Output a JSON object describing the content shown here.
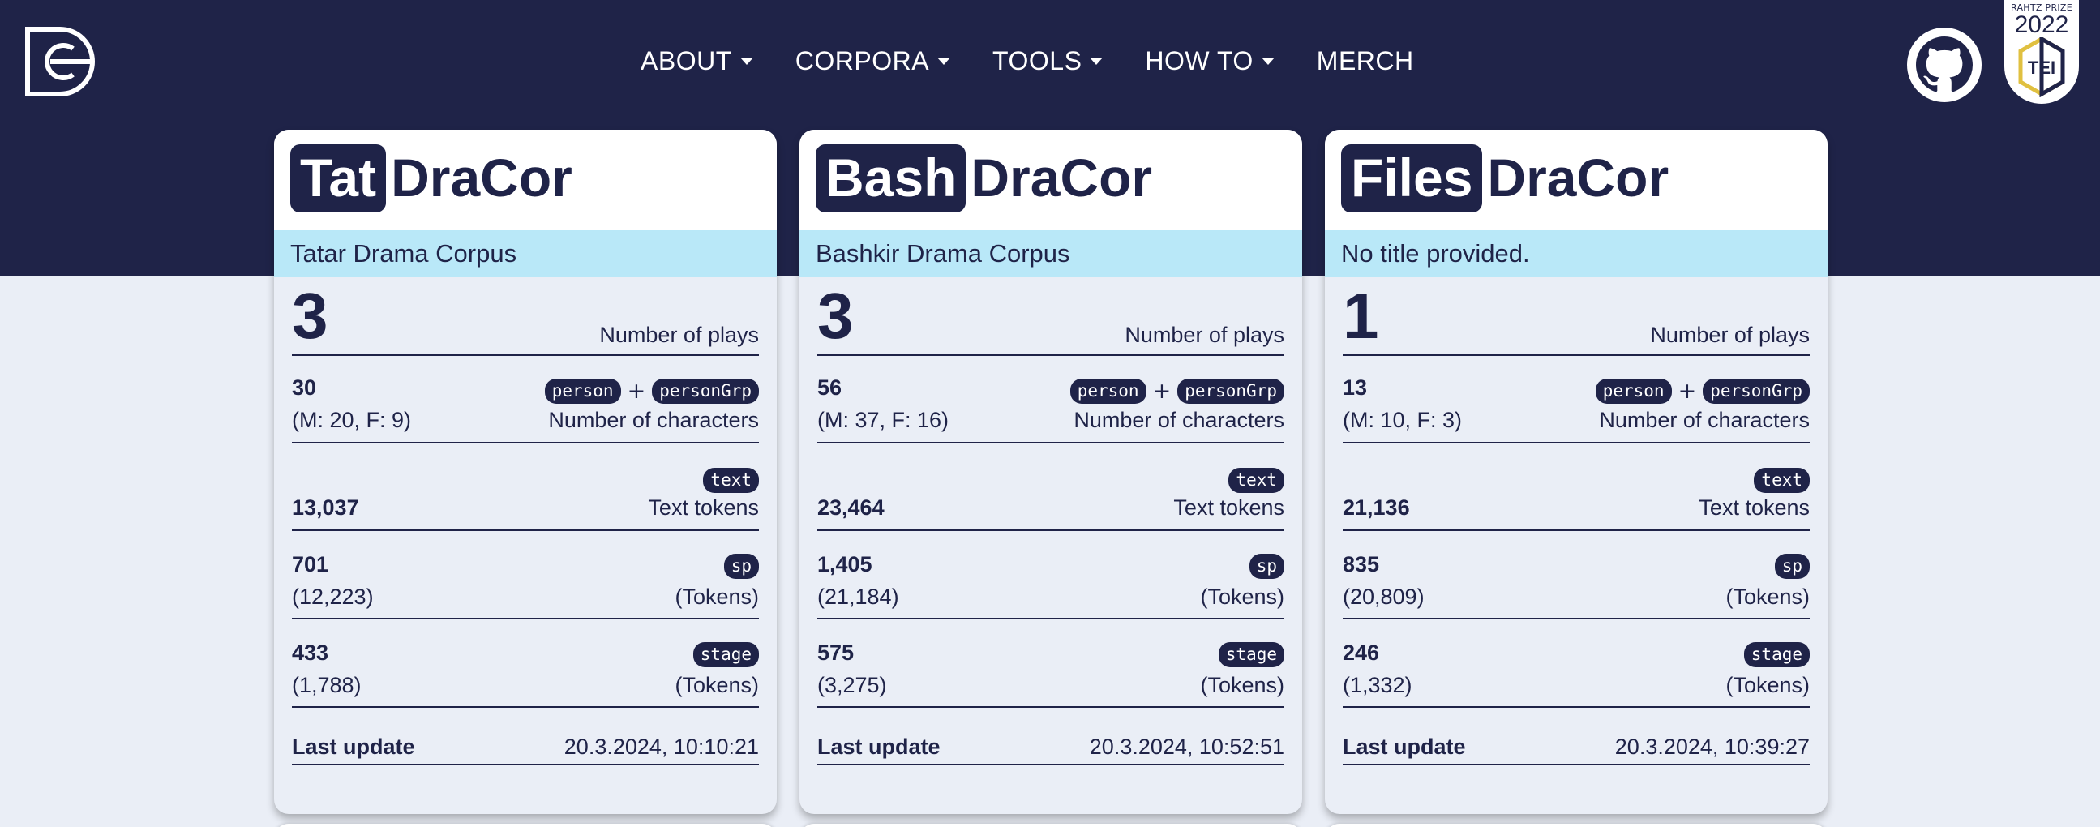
{
  "colors": {
    "navy": "#1f2348",
    "light_bg": "#eaeef6",
    "subtitle_bg": "#b9e8f8",
    "white": "#ffffff"
  },
  "logo": {
    "icon": "dracor-logo-icon"
  },
  "nav": [
    {
      "label": "ABOUT",
      "dropdown": true
    },
    {
      "label": "CORPORA",
      "dropdown": true
    },
    {
      "label": "TOOLS",
      "dropdown": true
    },
    {
      "label": "HOW TO",
      "dropdown": true
    },
    {
      "label": "MERCH",
      "dropdown": false
    }
  ],
  "github": {
    "icon": "github-icon"
  },
  "tei_badge": {
    "caption": "RAHTZ PRIZE",
    "year": "2022",
    "text": "TEI"
  },
  "cards": [
    {
      "abbr": "Tat",
      "brand": "DraCor",
      "subtitle": "Tatar Drama Corpus",
      "plays": "3",
      "plays_label": "Number of plays",
      "characters": "30",
      "characters_detail": "(M: 20, F: 9)",
      "characters_label": "Number of characters",
      "tag_person": "person",
      "tag_plus": "+",
      "tag_persongrp": "personGrp",
      "tag_text": "text",
      "text_tokens": "13,037",
      "text_label": "Text tokens",
      "tag_sp": "sp",
      "sp": "701",
      "sp_tokens": "(12,223)",
      "sp_label": "(Tokens)",
      "tag_stage": "stage",
      "stage": "433",
      "stage_tokens": "(1,788)",
      "stage_label": "(Tokens)",
      "update_label": "Last update",
      "update_value": "20.3.2024, 10:10:21"
    },
    {
      "abbr": "Bash",
      "brand": "DraCor",
      "subtitle": "Bashkir Drama Corpus",
      "plays": "3",
      "plays_label": "Number of plays",
      "characters": "56",
      "characters_detail": "(M: 37, F: 16)",
      "characters_label": "Number of characters",
      "tag_person": "person",
      "tag_plus": "+",
      "tag_persongrp": "personGrp",
      "tag_text": "text",
      "text_tokens": "23,464",
      "text_label": "Text tokens",
      "tag_sp": "sp",
      "sp": "1,405",
      "sp_tokens": "(21,184)",
      "sp_label": "(Tokens)",
      "tag_stage": "stage",
      "stage": "575",
      "stage_tokens": "(3,275)",
      "stage_label": "(Tokens)",
      "update_label": "Last update",
      "update_value": "20.3.2024, 10:52:51"
    },
    {
      "abbr": "Files",
      "brand": "DraCor",
      "subtitle": "No title provided.",
      "plays": "1",
      "plays_label": "Number of plays",
      "characters": "13",
      "characters_detail": "(M: 10, F: 3)",
      "characters_label": "Number of characters",
      "tag_person": "person",
      "tag_plus": "+",
      "tag_persongrp": "personGrp",
      "tag_text": "text",
      "text_tokens": "21,136",
      "text_label": "Text tokens",
      "tag_sp": "sp",
      "sp": "835",
      "sp_tokens": "(20,809)",
      "sp_label": "(Tokens)",
      "tag_stage": "stage",
      "stage": "246",
      "stage_tokens": "(1,332)",
      "stage_label": "(Tokens)",
      "update_label": "Last update",
      "update_value": "20.3.2024, 10:39:27"
    }
  ]
}
